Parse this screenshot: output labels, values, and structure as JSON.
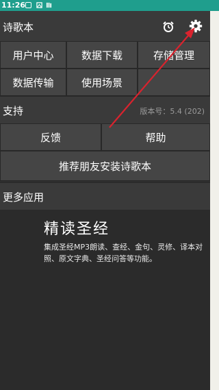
{
  "status_bar": {
    "time": "11:26"
  },
  "header": {
    "title": "诗歌本",
    "alarm_icon": "alarm-clock-icon",
    "settings_icon": "gear-icon"
  },
  "grid": {
    "user_center": "用户中心",
    "data_download": "数据下载",
    "storage_management": "存储管理",
    "data_transfer": "数据传输",
    "usage_scenarios": "使用场景"
  },
  "support": {
    "label": "支持",
    "version": "版本号：5.4 (202)",
    "feedback": "反馈",
    "help": "帮助",
    "recommend": "推荐朋友安装诗歌本"
  },
  "more_apps": {
    "label": "更多应用",
    "promo_title": "精读圣经",
    "promo_desc": "集成圣经MP3朗读、查经、金句、灵修、译本对照、原文字典、圣经问答等功能。"
  },
  "annotation": {
    "arrow_color": "#d9232e"
  }
}
